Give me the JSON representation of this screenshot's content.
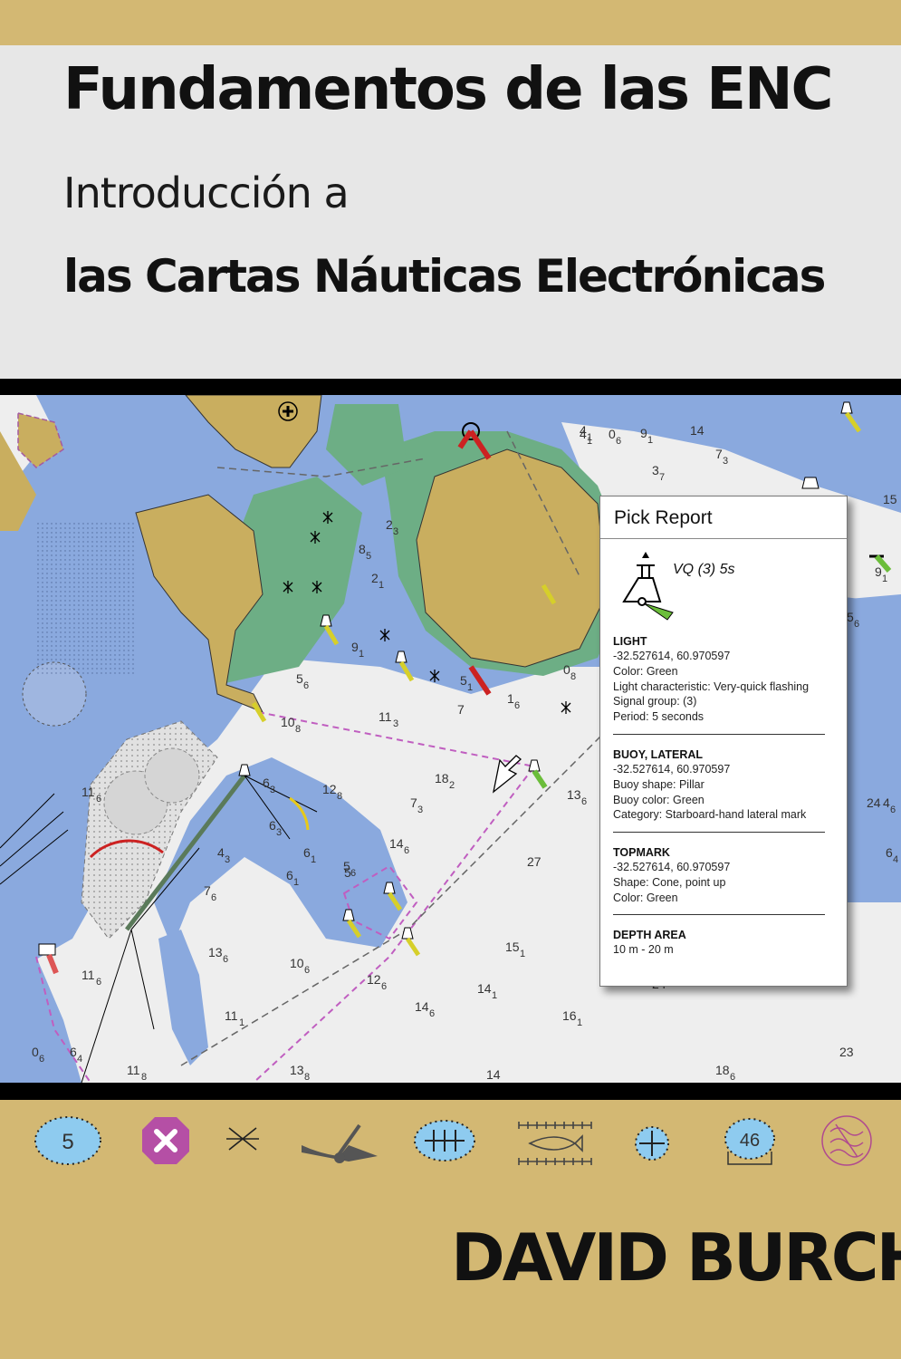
{
  "title": "Fundamentos de las ENC",
  "subtitle_line1": "Introducción a",
  "subtitle_line2": "las Cartas Náuticas Electrónicas",
  "author": "DAVID BURCH",
  "colors": {
    "band": "#d3b873",
    "panel": "#e7e7e7",
    "deep_water": "#eeeeee",
    "shallow_water": "#8aa9de",
    "intertidal": "#6dae85",
    "land": "#c9ae5f",
    "route": "#c05ec0"
  },
  "pick_report": {
    "title": "Pick Report",
    "symbol_label": "VQ (3) 5s",
    "sections": [
      {
        "heading": "LIGHT",
        "lines": [
          "-32.527614, 60.970597",
          "Color: Green",
          "Light characteristic: Very-quick flashing",
          "Signal group: (3)",
          "Period: 5 seconds"
        ]
      },
      {
        "heading": "BUOY, LATERAL",
        "lines": [
          "-32.527614, 60.970597",
          "Buoy shape: Pillar",
          "Buoy color: Green",
          "Category: Starboard-hand lateral mark"
        ]
      },
      {
        "heading": "TOPMARK",
        "lines": [
          "-32.527614, 60.970597",
          "Shape: Cone, point up",
          "Color: Green"
        ]
      },
      {
        "heading": "DEPTH AREA",
        "lines": [
          "10 m - 20 m"
        ]
      }
    ]
  },
  "soundings": [
    {
      "main": "14",
      "sub": ""
    },
    {
      "main": "9",
      "sub": "1"
    },
    {
      "main": "7",
      "sub": "3"
    },
    {
      "main": "3",
      "sub": "7"
    },
    {
      "main": "15",
      "sub": ""
    },
    {
      "main": "4",
      "sub": "1"
    },
    {
      "main": "0",
      "sub": "6"
    },
    {
      "main": "0",
      "sub": "8"
    },
    {
      "main": "11",
      "sub": "3"
    },
    {
      "main": "10",
      "sub": "8"
    },
    {
      "main": "18",
      "sub": "2"
    },
    {
      "main": "13",
      "sub": "6"
    },
    {
      "main": "27",
      "sub": ""
    },
    {
      "main": "12",
      "sub": "8"
    },
    {
      "main": "14",
      "sub": "6"
    },
    {
      "main": "11",
      "sub": "6"
    },
    {
      "main": "15",
      "sub": "1"
    },
    {
      "main": "14",
      "sub": "1"
    },
    {
      "main": "16",
      "sub": "1"
    },
    {
      "main": "23",
      "sub": ""
    },
    {
      "main": "18",
      "sub": "6"
    },
    {
      "main": "14",
      "sub": ""
    },
    {
      "main": "13",
      "sub": "8"
    },
    {
      "main": "11",
      "sub": "8"
    },
    {
      "main": "12",
      "sub": "6"
    },
    {
      "main": "10",
      "sub": "6"
    },
    {
      "main": "13",
      "sub": "6"
    },
    {
      "main": "11",
      "sub": "1"
    },
    {
      "main": "14",
      "sub": "6"
    },
    {
      "main": "5",
      "sub": "6"
    },
    {
      "main": "6",
      "sub": "1"
    },
    {
      "main": "6",
      "sub": "3"
    },
    {
      "main": "4",
      "sub": "3"
    },
    {
      "main": "7",
      "sub": "6"
    },
    {
      "main": "6",
      "sub": "3"
    },
    {
      "main": "6",
      "sub": "1"
    },
    {
      "main": "9",
      "sub": "1"
    },
    {
      "main": "4",
      "sub": "1"
    },
    {
      "main": "7",
      "sub": "3"
    },
    {
      "main": "4",
      "sub": "6"
    },
    {
      "main": "11",
      "sub": "6"
    },
    {
      "main": "8",
      "sub": "5"
    },
    {
      "main": "2",
      "sub": "3"
    },
    {
      "main": "5",
      "sub": ""
    },
    {
      "main": "2",
      "sub": "1"
    },
    {
      "main": "7",
      "sub": ""
    },
    {
      "main": "24",
      "sub": ""
    },
    {
      "main": "6",
      "sub": "4"
    },
    {
      "main": "0",
      "sub": "6"
    },
    {
      "main": "5",
      "sub": "6"
    },
    {
      "main": "24",
      "sub": ""
    },
    {
      "main": "5",
      "sub": "6"
    },
    {
      "main": "5",
      "sub": "1"
    },
    {
      "main": "1",
      "sub": "6"
    },
    {
      "main": "9",
      "sub": "1"
    },
    {
      "main": "6",
      "sub": "4"
    }
  ],
  "legend_symbols": [
    {
      "icon": "sounding-danger-5-icon",
      "label": "5"
    },
    {
      "icon": "wreck-danger-icon",
      "label": ""
    },
    {
      "icon": "rock-awash-icon",
      "label": ""
    },
    {
      "icon": "wreck-showing-hull-icon",
      "label": ""
    },
    {
      "icon": "wreck-dangerous-icon",
      "label": ""
    },
    {
      "icon": "fish-haven-icon",
      "label": ""
    },
    {
      "icon": "obstruction-icon",
      "label": ""
    },
    {
      "icon": "swept-sounding-icon",
      "label": "46"
    },
    {
      "icon": "overfalls-icon",
      "label": ""
    }
  ]
}
